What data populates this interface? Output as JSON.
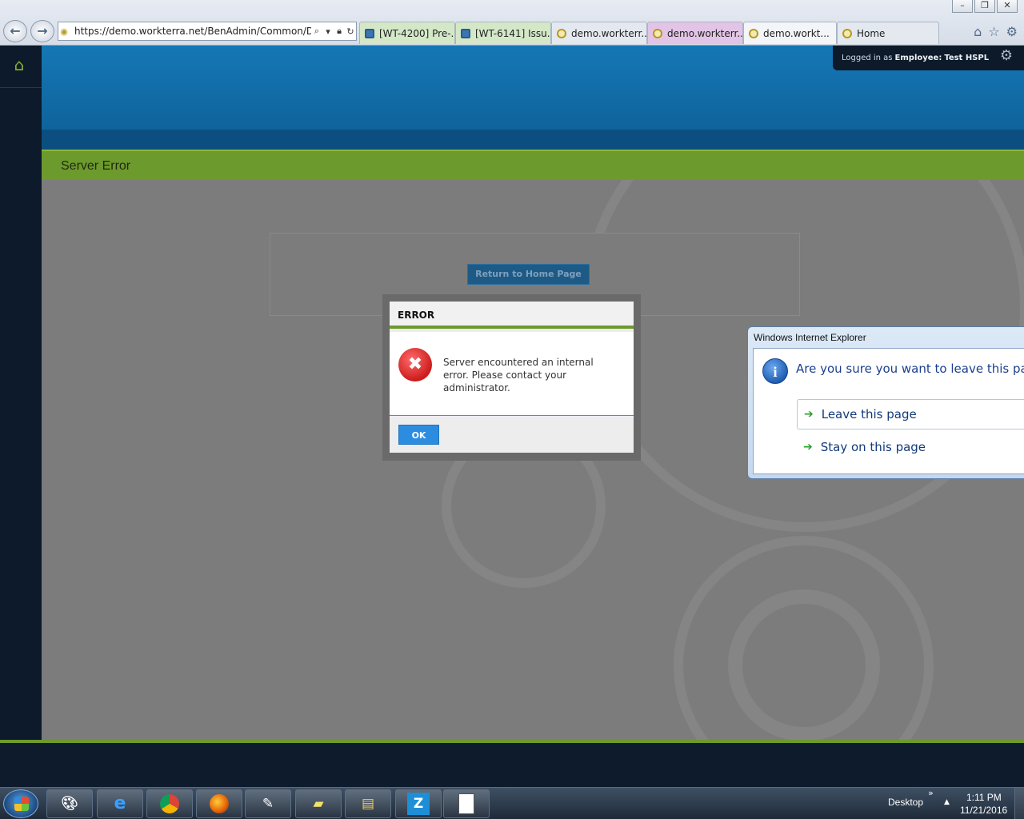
{
  "browser": {
    "address_url": "https://demo.workterra.net/BenAdmin/Common/Dc",
    "window_controls": [
      "minimize",
      "restore",
      "close"
    ],
    "tabs": [
      {
        "label": "[WT-4200] Pre-...",
        "icon": "jira-icon",
        "bg": "#d4e8c8"
      },
      {
        "label": "[WT-6141] Issu...",
        "icon": "jira-icon",
        "bg": "#d4e8c8"
      },
      {
        "label": "demo.workterr...",
        "icon": "site-icon",
        "bg": "#e4e9f0"
      },
      {
        "label": "demo.workterr...",
        "icon": "site-icon",
        "bg": "#e2c4e6"
      },
      {
        "label": "demo.workt...",
        "icon": "site-icon",
        "bg": "#f3f5f8",
        "active": true
      },
      {
        "label": "Home",
        "icon": "site-icon",
        "bg": "#e4e9f0"
      }
    ],
    "tab_close": "×"
  },
  "app": {
    "user_label_prefix": "Logged in as",
    "user_role": "Employee:",
    "user_name": "Test HSPL",
    "page_title": "Server Error",
    "return_button": "Return to Home Page",
    "accent_color": "#6d9a2c",
    "banner_color": "#1577b5"
  },
  "error_modal": {
    "title": "ERROR",
    "icon": "error-x-icon",
    "message": "Server encountered an internal error. Please contact your administrator.",
    "ok_label": "OK"
  },
  "ie_dialog": {
    "title": "Windows Internet Explorer",
    "question": "Are you sure you want to leave this page?",
    "leave_label": "Leave this page",
    "stay_label": "Stay on this page"
  },
  "taskbar": {
    "apps": [
      "paint-icon",
      "internet-explorer-icon",
      "chrome-icon",
      "firefox-icon",
      "notepad-icon",
      "sticky-notes-icon",
      "file-explorer-icon",
      "zoom-z-icon",
      "document-icon"
    ],
    "zoom_letter": "Z",
    "desktop_label": "Desktop",
    "time": "1:11 PM",
    "date": "11/21/2016"
  }
}
